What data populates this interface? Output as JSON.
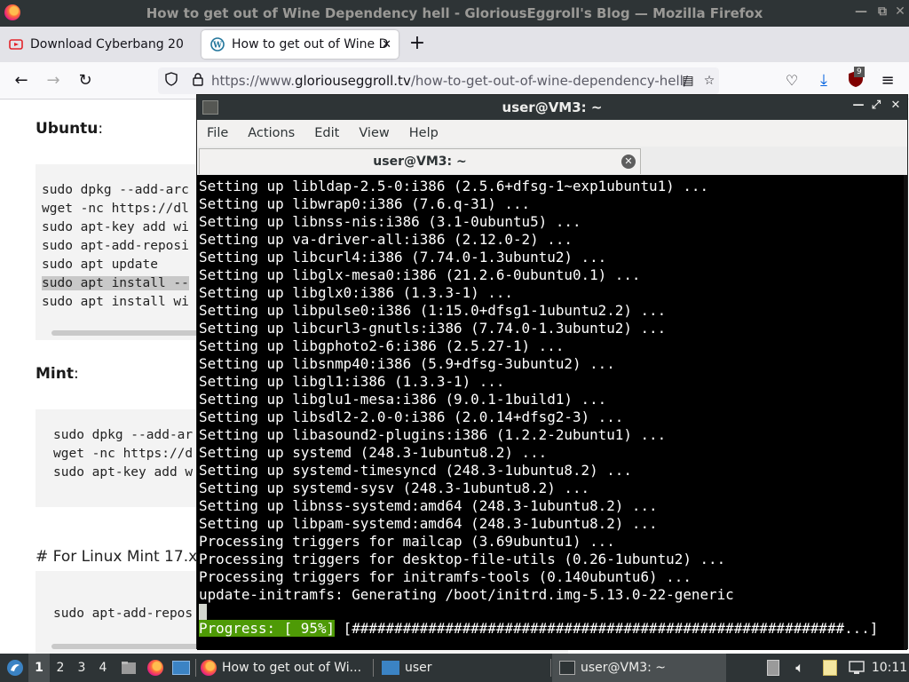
{
  "firefox": {
    "window_title": "How to get out of Wine Dependency hell - GloriousEggroll's Blog — Mozilla Firefox",
    "window_controls": [
      "minimize-icon",
      "maximize-icon",
      "close-icon"
    ],
    "tabs": [
      {
        "label": "Download Cyberbang 20",
        "icon": "youtube-icon"
      },
      {
        "label": "How to get out of Wine D",
        "icon": "wordpress-icon",
        "active": true
      }
    ],
    "url_prefix": "https://www.",
    "url_domain": "gloriouseggroll.tv",
    "url_path": "/how-to-get-out-of-wine-dependency-hell/",
    "extension_badge": "9"
  },
  "blog": {
    "ubuntu_heading": "Ubuntu",
    "ubuntu_code": [
      "sudo dpkg --add-arc",
      "wget -nc https://dl",
      "sudo apt-key add wi",
      "sudo apt-add-reposi",
      "sudo apt update",
      "sudo apt install --",
      "sudo apt install wi"
    ],
    "mint_heading": "Mint",
    "mint_code": [
      "sudo dpkg --add-ar",
      "wget -nc https://d",
      "sudo apt-key add w"
    ],
    "mint17_comment": "# For Linux Mint 17.x",
    "mint17_code": "sudo apt-add-repos",
    "colon": ":"
  },
  "terminal": {
    "title": "user@VM3: ~",
    "menu": [
      "File",
      "Actions",
      "Edit",
      "View",
      "Help"
    ],
    "tab_label": "user@VM3: ~",
    "lines": [
      "Setting up libldap-2.5-0:i386 (2.5.6+dfsg-1~exp1ubuntu1) ...",
      "Setting up libwrap0:i386 (7.6.q-31) ...",
      "Setting up libnss-nis:i386 (3.1-0ubuntu5) ...",
      "Setting up va-driver-all:i386 (2.12.0-2) ...",
      "Setting up libcurl4:i386 (7.74.0-1.3ubuntu2) ...",
      "Setting up libglx-mesa0:i386 (21.2.6-0ubuntu0.1) ...",
      "Setting up libglx0:i386 (1.3.3-1) ...",
      "Setting up libpulse0:i386 (1:15.0+dfsg1-1ubuntu2.2) ...",
      "Setting up libcurl3-gnutls:i386 (7.74.0-1.3ubuntu2) ...",
      "Setting up libgphoto2-6:i386 (2.5.27-1) ...",
      "Setting up libsnmp40:i386 (5.9+dfsg-3ubuntu2) ...",
      "Setting up libgl1:i386 (1.3.3-1) ...",
      "Setting up libglu1-mesa:i386 (9.0.1-1build1) ...",
      "Setting up libsdl2-2.0-0:i386 (2.0.14+dfsg2-3) ...",
      "Setting up libasound2-plugins:i386 (1.2.2-2ubuntu1) ...",
      "Setting up systemd (248.3-1ubuntu8.2) ...",
      "Setting up systemd-timesyncd (248.3-1ubuntu8.2) ...",
      "Setting up systemd-sysv (248.3-1ubuntu8.2) ...",
      "Setting up libnss-systemd:amd64 (248.3-1ubuntu8.2) ...",
      "Setting up libpam-systemd:amd64 (248.3-1ubuntu8.2) ...",
      "Processing triggers for mailcap (3.69ubuntu1) ...",
      "Processing triggers for desktop-file-utils (0.26-1ubuntu2) ...",
      "Processing triggers for initramfs-tools (0.140ubuntu6) ...",
      "update-initramfs: Generating /boot/initrd.img-5.13.0-22-generic"
    ],
    "progress_label": "Progress: [ 95%]",
    "progress_bar": " [##########################################################...]"
  },
  "taskbar": {
    "workspaces": [
      "1",
      "2",
      "3",
      "4"
    ],
    "tasks": [
      {
        "label": "How to get out of Wi...",
        "icon": "firefox-icon"
      },
      {
        "label": "user",
        "icon": "folder-icon"
      },
      {
        "label": "user@VM3: ~",
        "icon": "terminal-icon",
        "active": true
      }
    ],
    "clock": "10:11"
  }
}
